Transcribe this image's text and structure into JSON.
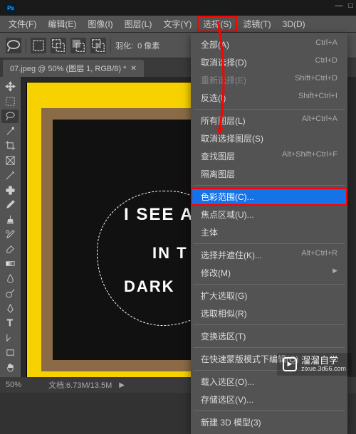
{
  "menubar": {
    "items": [
      "文件(F)",
      "编辑(E)",
      "图像(I)",
      "图层(L)",
      "文字(Y)",
      "选择(S)",
      "滤镜(T)",
      "3D(D)"
    ],
    "active_index": 5
  },
  "optionsbar": {
    "feather_label": "羽化:",
    "feather_value": "0 像素"
  },
  "tab": {
    "title": "07.jpeg @ 50% (图层 1, RGB/8) *"
  },
  "canvas": {
    "text1": "I SEE A",
    "text2": "IN T",
    "text3": "DARK"
  },
  "dropdown": {
    "items": [
      {
        "label": "全部(A)",
        "shortcut": "Ctrl+A",
        "type": "item"
      },
      {
        "label": "取消选择(D)",
        "shortcut": "Ctrl+D",
        "type": "item"
      },
      {
        "label": "重新选择(E)",
        "shortcut": "Shift+Ctrl+D",
        "type": "item",
        "disabled": true
      },
      {
        "label": "反选(I)",
        "shortcut": "Shift+Ctrl+I",
        "type": "item"
      },
      {
        "type": "divider"
      },
      {
        "label": "所有图层(L)",
        "shortcut": "Alt+Ctrl+A",
        "type": "item"
      },
      {
        "label": "取消选择图层(S)",
        "shortcut": "",
        "type": "item"
      },
      {
        "label": "查找图层",
        "shortcut": "Alt+Shift+Ctrl+F",
        "type": "item"
      },
      {
        "label": "隔离图层",
        "shortcut": "",
        "type": "item"
      },
      {
        "type": "divider"
      },
      {
        "label": "色彩范围(C)...",
        "shortcut": "",
        "type": "item",
        "highlighted": true
      },
      {
        "label": "焦点区域(U)...",
        "shortcut": "",
        "type": "item"
      },
      {
        "label": "主体",
        "shortcut": "",
        "type": "item"
      },
      {
        "type": "divider"
      },
      {
        "label": "选择并遮住(K)...",
        "shortcut": "Alt+Ctrl+R",
        "type": "item"
      },
      {
        "label": "修改(M)",
        "shortcut": "",
        "type": "submenu"
      },
      {
        "type": "divider"
      },
      {
        "label": "扩大选取(G)",
        "shortcut": "",
        "type": "item"
      },
      {
        "label": "选取相似(R)",
        "shortcut": "",
        "type": "item"
      },
      {
        "type": "divider"
      },
      {
        "label": "变换选区(T)",
        "shortcut": "",
        "type": "item"
      },
      {
        "type": "divider"
      },
      {
        "label": "在快速蒙版模式下编辑(Q)",
        "shortcut": "",
        "type": "item"
      },
      {
        "type": "divider"
      },
      {
        "label": "载入选区(O)...",
        "shortcut": "",
        "type": "item"
      },
      {
        "label": "存储选区(V)...",
        "shortcut": "",
        "type": "item"
      },
      {
        "type": "divider"
      },
      {
        "label": "新建 3D 模型(3)",
        "shortcut": "",
        "type": "item"
      }
    ]
  },
  "statusbar": {
    "zoom": "50%",
    "docinfo": "文档:6.73M/13.5M"
  },
  "watermark": {
    "name": "溜溜自学",
    "url": "zixue.3d66.com"
  }
}
